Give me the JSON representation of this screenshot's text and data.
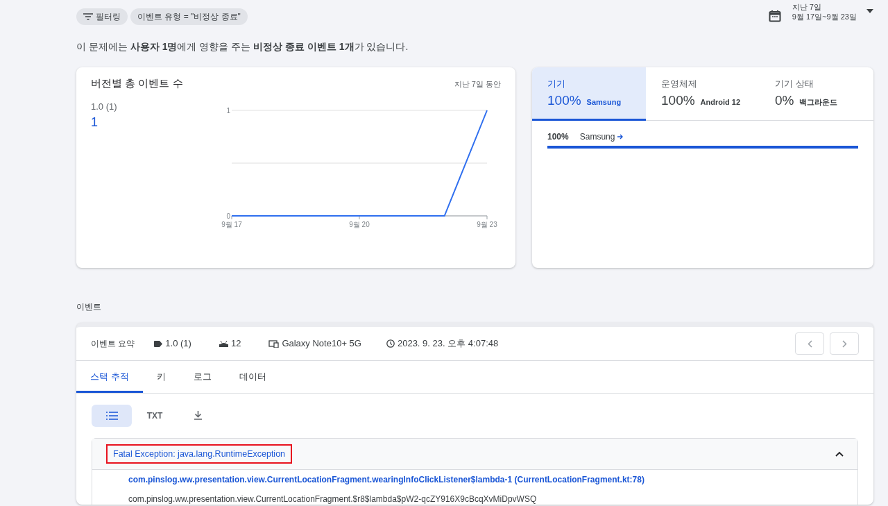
{
  "filters": {
    "filter_chip": "필터링",
    "chips": [
      "이벤트 유형 = \"비정상 종료\""
    ]
  },
  "date_range": {
    "label": "지난 7일",
    "range": "9월 17일~9월 23일"
  },
  "summary": "이 문제에는 **사용자 1명**에게 영향을 주는 **비정상 종료 이벤트 1개**가 있습니다.",
  "version_card": {
    "title": "버전별 총 이벤트 수",
    "period": "지난 7일 동안",
    "versions": [
      {
        "name": "1.0 (1)",
        "count": "1"
      }
    ],
    "chart_data": {
      "type": "line",
      "categories": [
        "9월 17",
        null,
        null,
        "9월 20",
        null,
        null,
        "9월 23"
      ],
      "series": [
        {
          "color": "#2f6fef",
          "values": [
            0,
            0,
            0,
            0,
            0,
            0,
            1
          ]
        }
      ],
      "yticks": [
        0,
        {
          "value": 0.5,
          "label": null
        },
        1
      ],
      "ylim": [
        0,
        1
      ]
    }
  },
  "breakdown": {
    "tabs": [
      {
        "label": "기기",
        "percent": "100%",
        "value": "Samsung",
        "selected": true
      },
      {
        "label": "운영체제",
        "percent": "100%",
        "value": "Android 12",
        "selected": false
      },
      {
        "label": "기기 상태",
        "percent": "0%",
        "value": "백그라운드",
        "selected": false
      }
    ],
    "rows": [
      {
        "percent": "100%",
        "name": "Samsung",
        "level": 1.0
      }
    ]
  },
  "events_label": "이벤트",
  "event": {
    "title": "이벤트 요약",
    "version": "1.0 (1)",
    "os": "12",
    "device": "Galaxy Note10+ 5G",
    "time": "2023. 9. 23. 오후 4:07:48",
    "tabs": [
      {
        "label": "스택 추적",
        "selected": true
      },
      {
        "label": "키",
        "selected": false
      },
      {
        "label": "로그",
        "selected": false
      },
      {
        "label": "데이터",
        "selected": false
      }
    ],
    "views": [
      {
        "kind": "list",
        "selected": true
      },
      {
        "kind": "txt",
        "label": "TXT",
        "selected": false
      },
      {
        "kind": "download",
        "selected": false
      }
    ],
    "exception": {
      "title": "Fatal Exception: java.lang.RuntimeException",
      "highlighted": true,
      "expanded": true,
      "frames": [
        {
          "text": "com.pinslog.ww.presentation.view.CurrentLocationFragment.wearingInfoClickListener$lambda-1 (CurrentLocationFragment.kt:78)",
          "highlighted": true
        },
        {
          "text": "com.pinslog.ww.presentation.view.CurrentLocationFragment.$r8$lambda$pW2-qcZY916X9cBcqXvMiDpvWSQ",
          "highlighted": false
        }
      ]
    }
  }
}
